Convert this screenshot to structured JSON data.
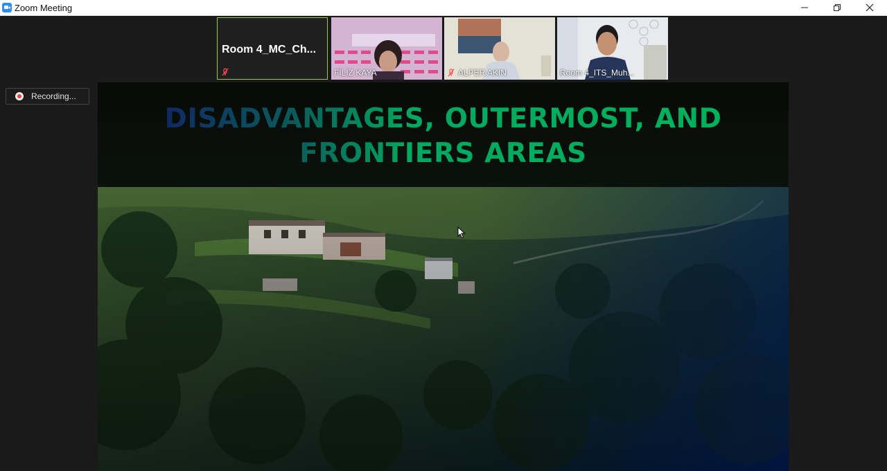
{
  "window": {
    "title": "Zoom Meeting",
    "controls": [
      "minimize",
      "restore",
      "close"
    ]
  },
  "participants": [
    {
      "name": "Room  4_MC_Ch...",
      "display": "name-only",
      "muted": true,
      "active_speaker": true
    },
    {
      "name": "FİLİZ KAYA",
      "display": "video",
      "muted": false
    },
    {
      "name": "ALPER AKIN",
      "display": "video",
      "muted": true
    },
    {
      "name": "Room 4_ITS_Muh...",
      "display": "video",
      "muted": false
    }
  ],
  "recording": {
    "label": "Recording..."
  },
  "shared_screen": {
    "title_line1": "DISADVANTAGES, OUTERMOST, AND",
    "title_line2": "FRONTIERS AREAS",
    "image_description_icon": "mountain-village-photo"
  },
  "colors": {
    "accent_active_border": "#9acd32",
    "title_gradient_start": "#0f2a63",
    "title_gradient_end": "#00b35a",
    "recording_dot": "#e8474a",
    "zoom_blue": "#2d8cff"
  }
}
